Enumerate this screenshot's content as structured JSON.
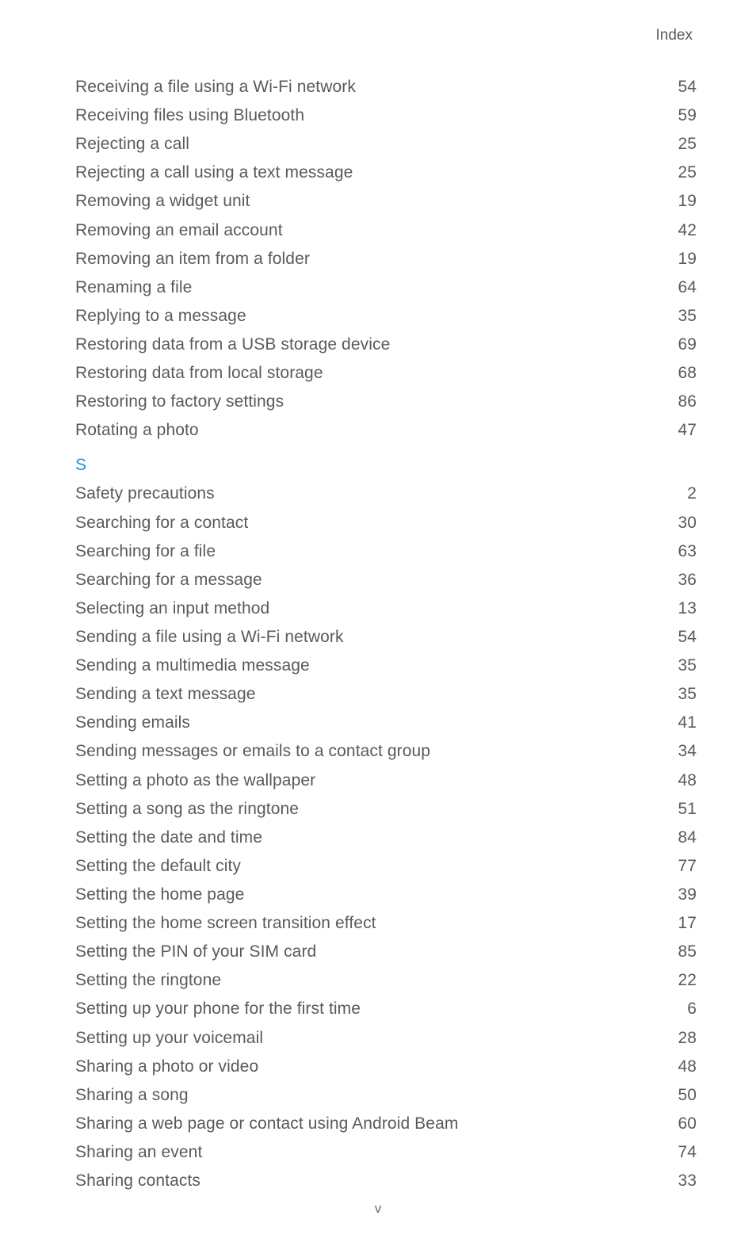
{
  "header": {
    "title": "Index"
  },
  "sections": [
    {
      "letter": null,
      "entries": [
        {
          "label": "Receiving a file using a Wi-Fi network",
          "page": "54"
        },
        {
          "label": "Receiving files using Bluetooth",
          "page": "59"
        },
        {
          "label": "Rejecting a call",
          "page": "25"
        },
        {
          "label": "Rejecting a call using a text message",
          "page": "25"
        },
        {
          "label": "Removing a widget unit",
          "page": "19"
        },
        {
          "label": "Removing an email account",
          "page": "42"
        },
        {
          "label": "Removing an item from a folder",
          "page": "19"
        },
        {
          "label": "Renaming a file",
          "page": "64"
        },
        {
          "label": "Replying to a message",
          "page": "35"
        },
        {
          "label": "Restoring data from a USB storage device",
          "page": "69"
        },
        {
          "label": "Restoring data from local storage",
          "page": "68"
        },
        {
          "label": "Restoring to factory settings",
          "page": "86"
        },
        {
          "label": "Rotating a photo",
          "page": "47"
        }
      ]
    },
    {
      "letter": "S",
      "entries": [
        {
          "label": "Safety precautions",
          "page": "2"
        },
        {
          "label": "Searching for a contact",
          "page": "30"
        },
        {
          "label": "Searching for a file",
          "page": "63"
        },
        {
          "label": "Searching for a message",
          "page": "36"
        },
        {
          "label": "Selecting an input method",
          "page": "13"
        },
        {
          "label": "Sending a file using a Wi-Fi network",
          "page": "54"
        },
        {
          "label": "Sending a multimedia message",
          "page": "35"
        },
        {
          "label": "Sending a text message",
          "page": "35"
        },
        {
          "label": "Sending emails",
          "page": "41"
        },
        {
          "label": "Sending messages or emails to a contact group",
          "page": "34"
        },
        {
          "label": "Setting a photo as the wallpaper",
          "page": "48"
        },
        {
          "label": "Setting a song as the ringtone",
          "page": "51"
        },
        {
          "label": "Setting the date and time",
          "page": "84"
        },
        {
          "label": "Setting the default city",
          "page": "77"
        },
        {
          "label": "Setting the home page",
          "page": "39"
        },
        {
          "label": "Setting the home screen transition effect",
          "page": "17"
        },
        {
          "label": "Setting the PIN of your SIM card",
          "page": "85"
        },
        {
          "label": "Setting the ringtone",
          "page": "22"
        },
        {
          "label": "Setting up your phone for the first time",
          "page": "6"
        },
        {
          "label": "Setting up your voicemail",
          "page": "28"
        },
        {
          "label": "Sharing a photo or video",
          "page": "48"
        },
        {
          "label": "Sharing a song",
          "page": "50"
        },
        {
          "label": "Sharing a web page or contact using Android Beam",
          "page": "60"
        },
        {
          "label": "Sharing an event",
          "page": "74"
        },
        {
          "label": "Sharing contacts",
          "page": "33"
        }
      ]
    }
  ],
  "footer": {
    "pagenum": "v"
  }
}
